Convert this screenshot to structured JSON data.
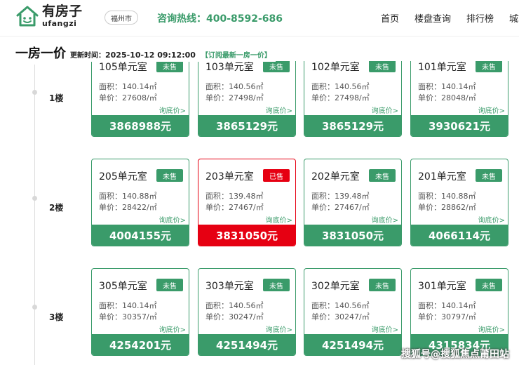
{
  "header": {
    "logo_cn": "有房子",
    "logo_en": "ufangzi",
    "city": "福州市",
    "hotline_label": "咨询热线：",
    "hotline_number": "400-8592-686",
    "nav": [
      "首页",
      "楼盘查询",
      "排行榜",
      "城市"
    ]
  },
  "titlebar": {
    "title": "一房一价",
    "update_label": "更新时间：",
    "update_time": "2025-10-12 09:12:00",
    "subscribe": "【订阅最新一房一价】"
  },
  "floors": [
    {
      "label": "1楼",
      "units": [
        {
          "room": "105单元室",
          "status": "未售",
          "sold": false,
          "area": "面积：140.14㎡",
          "unit_price": "单价：27608/㎡",
          "inquiry": "询底价>",
          "total": "3868988元"
        },
        {
          "room": "103单元室",
          "status": "未售",
          "sold": false,
          "area": "面积：140.56㎡",
          "unit_price": "单价：27498/㎡",
          "inquiry": "询底价>",
          "total": "3865129元"
        },
        {
          "room": "102单元室",
          "status": "未售",
          "sold": false,
          "area": "面积：140.56㎡",
          "unit_price": "单价：27498/㎡",
          "inquiry": "询底价>",
          "total": "3865129元"
        },
        {
          "room": "101单元室",
          "status": "未售",
          "sold": false,
          "area": "面积：140.14㎡",
          "unit_price": "单价：28048/㎡",
          "inquiry": "询底价>",
          "total": "3930621元"
        }
      ]
    },
    {
      "label": "2楼",
      "units": [
        {
          "room": "205单元室",
          "status": "未售",
          "sold": false,
          "area": "面积：140.88㎡",
          "unit_price": "单价：28422/㎡",
          "inquiry": "询底价>",
          "total": "4004155元"
        },
        {
          "room": "203单元室",
          "status": "已售",
          "sold": true,
          "area": "面积：139.48㎡",
          "unit_price": "单价：27467/㎡",
          "inquiry": "询底价>",
          "total": "3831050元"
        },
        {
          "room": "202单元室",
          "status": "未售",
          "sold": false,
          "area": "面积：139.48㎡",
          "unit_price": "单价：27467/㎡",
          "inquiry": "询底价>",
          "total": "3831050元"
        },
        {
          "room": "201单元室",
          "status": "未售",
          "sold": false,
          "area": "面积：140.88㎡",
          "unit_price": "单价：28862/㎡",
          "inquiry": "询底价>",
          "total": "4066114元"
        }
      ]
    },
    {
      "label": "3楼",
      "units": [
        {
          "room": "305单元室",
          "status": "未售",
          "sold": false,
          "area": "面积：140.14㎡",
          "unit_price": "单价：30357/㎡",
          "inquiry": "询底价>",
          "total": "4254201元"
        },
        {
          "room": "303单元室",
          "status": "未售",
          "sold": false,
          "area": "面积：140.56㎡",
          "unit_price": "单价：30247/㎡",
          "inquiry": "询底价>",
          "total": "4251494元"
        },
        {
          "room": "302单元室",
          "status": "未售",
          "sold": false,
          "area": "面积：140.56㎡",
          "unit_price": "单价：30247/㎡",
          "inquiry": "询底价>",
          "total": "4251494元"
        },
        {
          "room": "301单元室",
          "status": "未售",
          "sold": false,
          "area": "面积：140.14㎡",
          "unit_price": "单价：30797/㎡",
          "inquiry": "询底价>",
          "total": "4315834元"
        }
      ]
    }
  ],
  "watermark": "搜狐号@搜狐焦点莆田站",
  "colors": {
    "accent": "#3a9b6a",
    "sold": "#e60012"
  }
}
